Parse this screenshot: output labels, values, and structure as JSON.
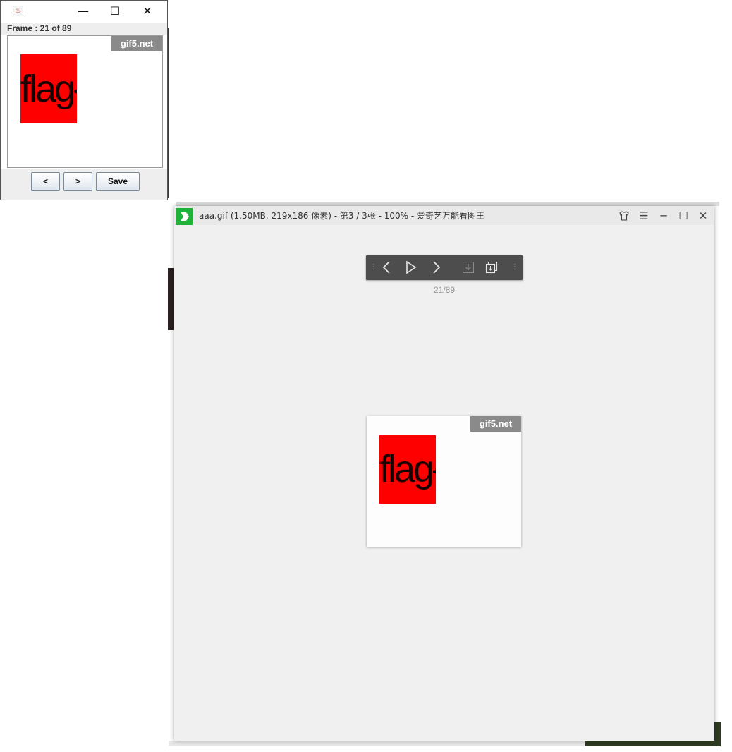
{
  "java_window": {
    "title_icon": "java-cup-icon",
    "minimize": "—",
    "maximize": "☐",
    "close": "✕",
    "frame_label": "Frame : 21 of 89",
    "watermark": "gif5.net",
    "image_text": "flag{",
    "buttons": {
      "prev": "<",
      "next": ">",
      "save": "Save"
    }
  },
  "viewer": {
    "title": "aaa.gif (1.50MB, 219x186 像素) - 第3 / 3张 - 100% - 爱奇艺万能看图王",
    "controls": {
      "skin": "shirt-icon",
      "menu": "menu-icon",
      "minimize": "minimize-icon",
      "maximize": "maximize-icon",
      "close": "close-icon"
    },
    "toolbar": {
      "prev": "chevron-left-icon",
      "play": "play-icon",
      "next": "chevron-right-icon",
      "export": "export-frame-icon",
      "export_all": "export-all-icon"
    },
    "counter": "21/89",
    "watermark": "gif5.net",
    "image_text": "flag{"
  },
  "colors": {
    "red": "#ff0000",
    "watermark_bg": "#8a8a8a",
    "toolbar_bg": "#4d4d4d",
    "logo_green": "#1fb23a"
  }
}
